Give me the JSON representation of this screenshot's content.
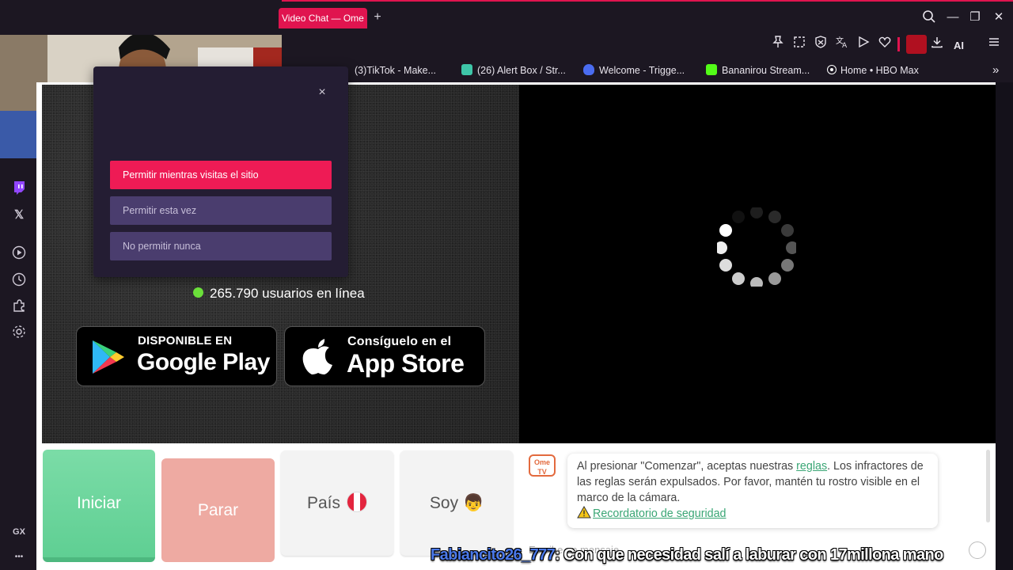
{
  "browser": {
    "tab_title": "Video Chat — Ome",
    "new_tab": "+",
    "window_controls": {
      "search": "⌕",
      "minimize": "—",
      "restore": "❐",
      "close": "✕"
    },
    "toolbar": {
      "icons": [
        "pin-icon",
        "snapshot-icon",
        "adblock-icon",
        "translate-icon",
        "send-icon",
        "heart-icon",
        "avatar-icon",
        "download-icon",
        "ai-icon",
        "menu-icon"
      ],
      "ai_label": "AI"
    },
    "bookmarks": [
      {
        "label": "(3)TikTok - Make...",
        "icon_color": "#222222"
      },
      {
        "label": "(26) Alert Box / Str...",
        "icon_color": "#3ec6a8"
      },
      {
        "label": "Welcome - Trigge...",
        "icon_color": "#4a6cf0"
      },
      {
        "label": "Bananirou Stream...",
        "icon_color": "#53fc18"
      },
      {
        "label": "Home • HBO Max",
        "icon_color": "#ffffff"
      }
    ],
    "bookmarks_more": "»"
  },
  "sidebar": {
    "items": [
      "twitch-icon",
      "x-icon",
      "player-icon",
      "history-icon",
      "extensions-icon",
      "settings-icon"
    ],
    "gx_label": "GX",
    "more_label": "•••"
  },
  "permission_popup": {
    "close": "×",
    "allow": "Permitir mientras visitas el sitio",
    "allow_once": "Permitir esta vez",
    "never": "No permitir nunca"
  },
  "stats": {
    "online": "265.790 usuarios en línea",
    "status_color": "#6be03a"
  },
  "stores": {
    "google_small": "DISPONIBLE EN",
    "google_big": "Google Play",
    "apple_small": "Consíguelo en el",
    "apple_big": "App Store"
  },
  "controls": {
    "start": "Iniciar",
    "stop": "Parar",
    "country": "País",
    "soy": "Soy",
    "soy_emoji": "👦"
  },
  "chat": {
    "logo_top": "Ome",
    "logo_bottom": "TV",
    "notice_1": "Al presionar \"Comenzar\", aceptas nuestras ",
    "notice_link": "reglas",
    "notice_2": ". Los infractores de las reglas serán expulsados. Por favor, mantén tu rostro visible en el marco de la cámara.",
    "safety_link": "Recordatorio de seguridad",
    "input_placeholder": "Escribe un mensaje"
  },
  "stream_overlay": {
    "user": "Fabiancito26_777",
    "message": ": Con que necesidad salí a laburar con 17millona mano"
  }
}
